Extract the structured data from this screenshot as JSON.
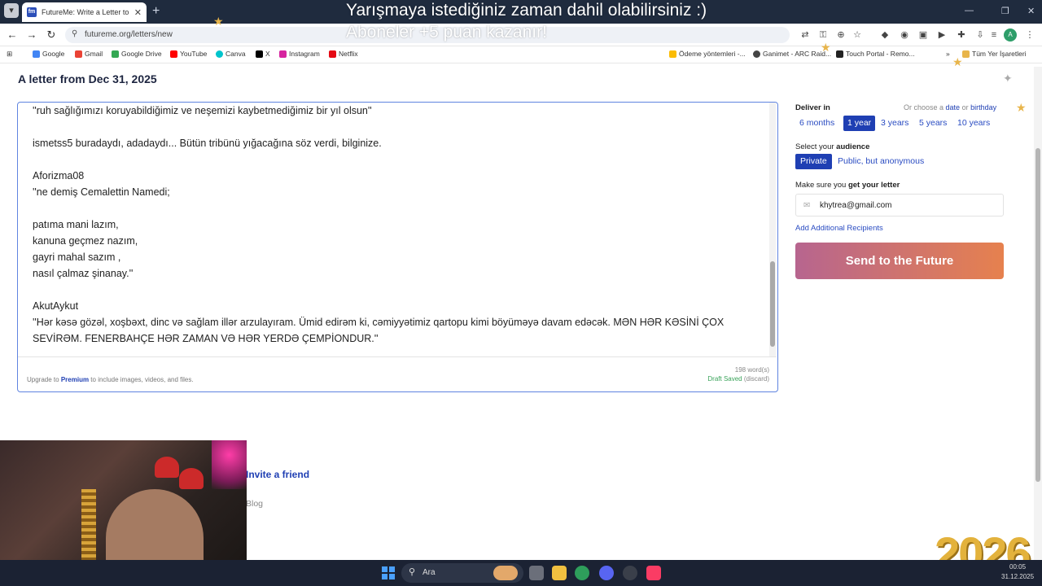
{
  "browser": {
    "tab_title": "FutureMe: Write a Letter to the",
    "tab_favicon": "fm",
    "url": "futureme.org/letters/new",
    "profile_initial": "A",
    "bookmarks": [
      {
        "label": "Google",
        "color": "#4285f4"
      },
      {
        "label": "Gmail",
        "color": "#ea4335"
      },
      {
        "label": "Google Drive",
        "color": "#34a853"
      },
      {
        "label": "YouTube",
        "color": "#ff0000"
      },
      {
        "label": "Canva",
        "color": "#00c4cc"
      },
      {
        "label": "X",
        "color": "#000000"
      },
      {
        "label": "Instagram",
        "color": "#d6249f"
      },
      {
        "label": "Netflix",
        "color": "#e50914"
      },
      {
        "label": "Ödeme yöntemleri -...",
        "color": "#fbbc04"
      },
      {
        "label": "Ganimet - ARC Raid...",
        "color": "#444444"
      },
      {
        "label": "Touch Portal - Remo...",
        "color": "#222222"
      },
      {
        "label": "Tüm Yer İşaretleri",
        "color": "#e8b54b"
      }
    ]
  },
  "overlay": {
    "banner_line1": "Yarışmaya istediğiniz zaman dahil olabilirsiniz :)",
    "banner_line2": "Aboneler +5 puan kazanır!",
    "year_badge": "2026"
  },
  "page": {
    "title": "A letter from Dec 31, 2025",
    "letter_body": "''ruh sağlığımızı koruyabildiğimiz ve neşemizi kaybetmediğimiz bir yıl olsun''\n\nismetss5 buradaydı, adadaydı... Bütün tribünü yığacağına söz verdi, bilginize.\n\nAforizma08\n''ne demiş Cemalettin Namedi;\n\npatıma mani lazım,\nkanuna geçmez nazım,\ngayri mahal sazım ,\nnasıl çalmaz şinanay.''\n\nAkutAykut\n''Hər kəsə gözəl, xoşbəxt, dinc və sağlam illər arzulayıram. Ümid edirəm ki, cəmiyyətimiz qartopu kimi böyüməyə davam edəcək. MƏN HƏR KƏSİNİ ÇOX SEVİRƏM. FENERBAHÇE HƏR ZAMAN VƏ HƏR YERDƏ ÇEMPİONDUR.''",
    "word_count": "198 word(s)",
    "draft_status": "Draft Saved",
    "draft_discard": "(discard)",
    "upgrade_prefix": "Upgrade to",
    "upgrade_link": "Premium",
    "upgrade_suffix": "to include images, videos, and files."
  },
  "sidebar": {
    "deliver_label": "Deliver in",
    "or_choose_prefix": "Or choose a",
    "or_choose_date": "date",
    "or_choose_or": "or",
    "or_choose_birthday": "birthday",
    "deliver_options": [
      "6 months",
      "1 year",
      "3 years",
      "5 years",
      "10 years"
    ],
    "deliver_selected": "1 year",
    "audience_label_prefix": "Select your",
    "audience_label_bold": "audience",
    "audience_options": [
      "Private",
      "Public, but anonymous"
    ],
    "audience_selected": "Private",
    "email_label_prefix": "Make sure you",
    "email_label_bold": "get your letter",
    "email_value": "khytrea@gmail.com",
    "add_recipients": "Add Additional Recipients",
    "send_button": "Send to the Future"
  },
  "footer": {
    "invite": "Invite a friend",
    "blog": "Blog"
  },
  "taskbar": {
    "search_placeholder": "Ara",
    "time": "00:05",
    "date": "31.12.2025",
    "accent": "#4aa0ff"
  }
}
